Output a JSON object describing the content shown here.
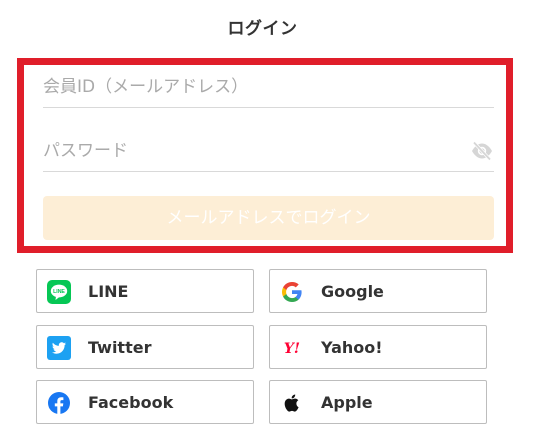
{
  "title": "ログイン",
  "form": {
    "email_placeholder": "会員ID（メールアドレス）",
    "email_value": "",
    "password_placeholder": "パスワード",
    "password_value": "",
    "submit_label": "メールアドレスでログイン",
    "submit_state": "disabled"
  },
  "social": [
    {
      "label": "LINE",
      "icon": "line-icon"
    },
    {
      "label": "Google",
      "icon": "google-icon"
    },
    {
      "label": "Twitter",
      "icon": "twitter-icon"
    },
    {
      "label": "Yahoo!",
      "icon": "yahoo-icon"
    },
    {
      "label": "Facebook",
      "icon": "facebook-icon"
    },
    {
      "label": "Apple",
      "icon": "apple-icon"
    }
  ],
  "colors": {
    "highlight_border": "#e01e2a",
    "submit_disabled_bg": "#fdeed6",
    "line_green": "#06c755",
    "twitter_blue": "#1da1f2",
    "facebook_blue": "#1877f2",
    "yahoo_red": "#ff0033"
  }
}
